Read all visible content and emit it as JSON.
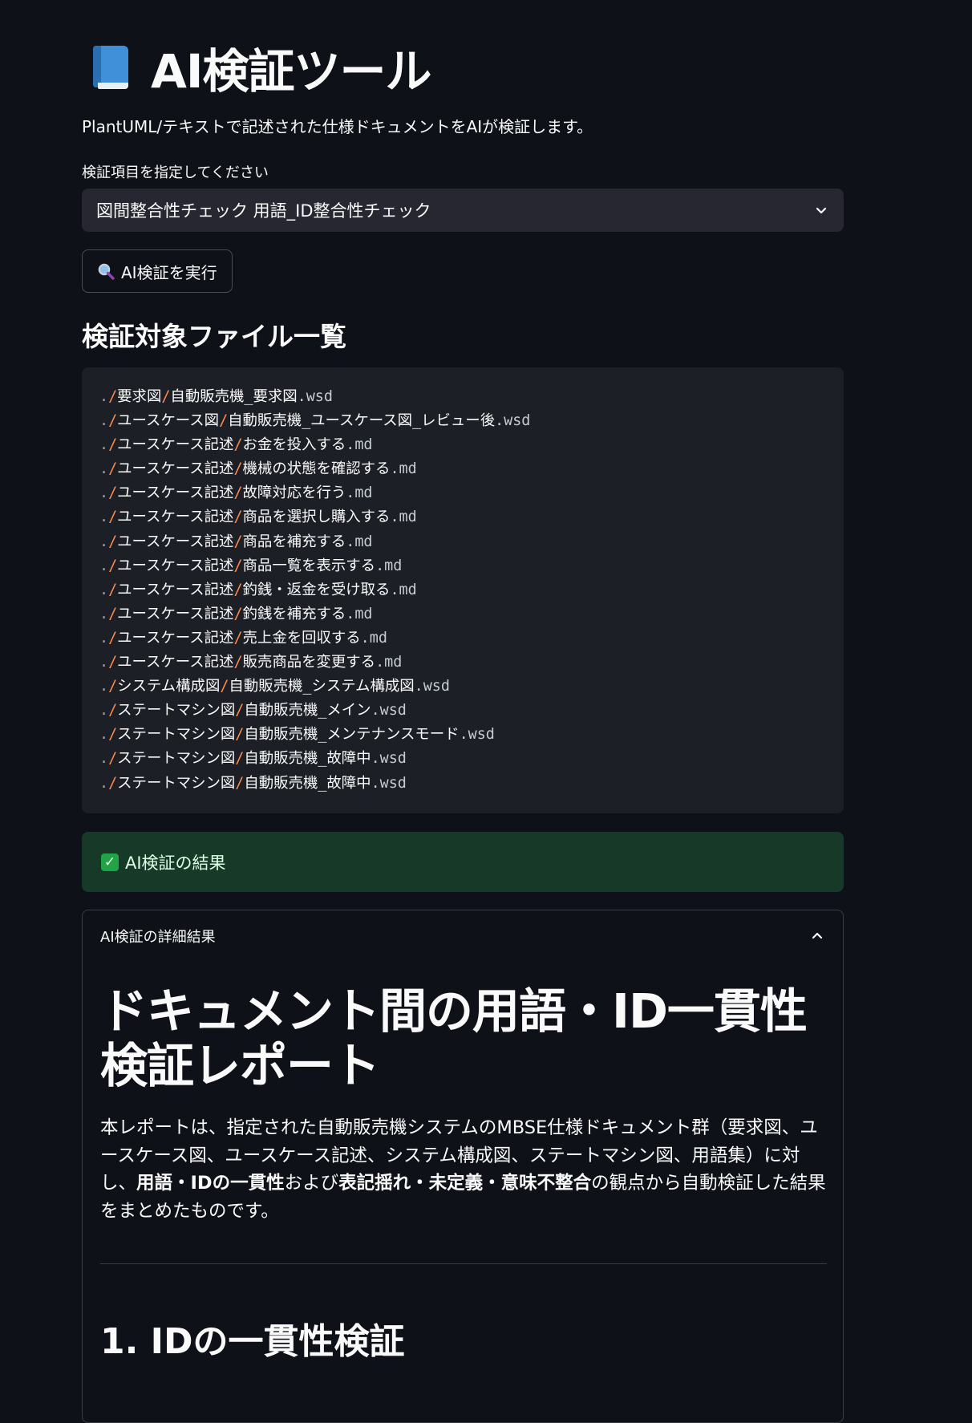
{
  "app": {
    "title": "AI検証ツール",
    "title_icon": "book-icon",
    "subtitle": "PlantUML/テキストで記述された仕様ドキュメントをAIが検証します。"
  },
  "select": {
    "label": "検証項目を指定してください",
    "value": "図間整合性チェック 用語_ID整合性チェック"
  },
  "run_button": {
    "icon": "magnifier-icon",
    "label": "AI検証を実行"
  },
  "files": {
    "heading": "検証対象ファイル一覧",
    "items": [
      {
        "dir": "要求図",
        "name": "自動販売機_要求図",
        "ext": "wsd"
      },
      {
        "dir": "ユースケース図",
        "name": "自動販売機_ユースケース図_レビュー後",
        "ext": "wsd"
      },
      {
        "dir": "ユースケース記述",
        "name": "お金を投入する",
        "ext": "md"
      },
      {
        "dir": "ユースケース記述",
        "name": "機械の状態を確認する",
        "ext": "md"
      },
      {
        "dir": "ユースケース記述",
        "name": "故障対応を行う",
        "ext": "md"
      },
      {
        "dir": "ユースケース記述",
        "name": "商品を選択し購入する",
        "ext": "md"
      },
      {
        "dir": "ユースケース記述",
        "name": "商品を補充する",
        "ext": "md"
      },
      {
        "dir": "ユースケース記述",
        "name": "商品一覧を表示する",
        "ext": "md"
      },
      {
        "dir": "ユースケース記述",
        "name": "釣銭・返金を受け取る",
        "ext": "md"
      },
      {
        "dir": "ユースケース記述",
        "name": "釣銭を補充する",
        "ext": "md"
      },
      {
        "dir": "ユースケース記述",
        "name": "売上金を回収する",
        "ext": "md"
      },
      {
        "dir": "ユースケース記述",
        "name": "販売商品を変更する",
        "ext": "md"
      },
      {
        "dir": "システム構成図",
        "name": "自動販売機_システム構成図",
        "ext": "wsd"
      },
      {
        "dir": "ステートマシン図",
        "name": "自動販売機_メイン",
        "ext": "wsd"
      },
      {
        "dir": "ステートマシン図",
        "name": "自動販売機_メンテナンスモード",
        "ext": "wsd"
      },
      {
        "dir": "ステートマシン図",
        "name": "自動販売機_故障中",
        "ext": "wsd"
      },
      {
        "dir": "ステートマシン図",
        "name": "自動販売機_故障中",
        "ext": "wsd"
      }
    ]
  },
  "success": {
    "icon": "check-icon",
    "text": "AI検証の結果"
  },
  "expander": {
    "label": "AI検証の詳細結果",
    "report": {
      "title": "ドキュメント間の用語・ID一貫性検証レポート",
      "intro_1": "本レポートは、指定された自動販売機システムのMBSE仕様ドキュメント群（要求図、ユースケース図、ユースケース記述、システム構成図、ステートマシン図、用語集）に対し、",
      "intro_bold_1": "用語・IDの一貫性",
      "intro_2": "および",
      "intro_bold_2": "表記揺れ・未定義・意味不整合",
      "intro_3": "の観点から自動検証した結果をまとめたものです。",
      "section_1": "1. IDの一貫性検証"
    }
  },
  "colors": {
    "background": "#0e1117",
    "select_bg": "#262730",
    "code_bg": "#1c1f26",
    "path_sep": "#ff8a4c",
    "success_bg": "#173928"
  }
}
